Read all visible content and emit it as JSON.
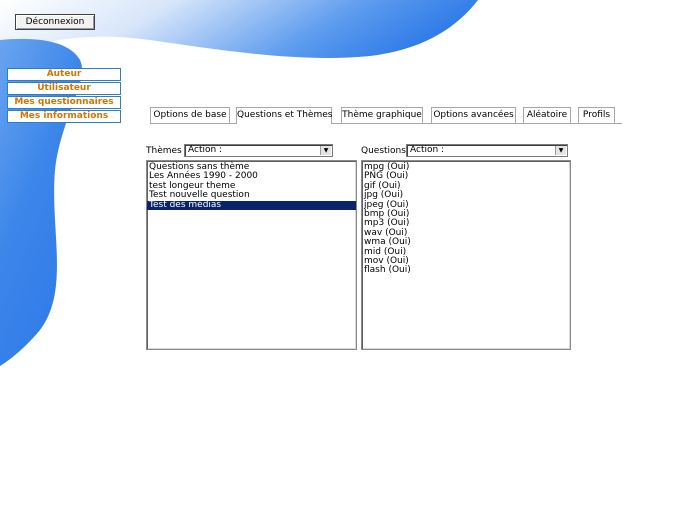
{
  "header": {
    "logout_label": "Déconnexion"
  },
  "side_menu": {
    "items": [
      {
        "label": "Auteur"
      },
      {
        "label": "Utilisateur"
      },
      {
        "label": "Mes questionnaires"
      },
      {
        "label": "Mes informations"
      }
    ]
  },
  "tabs": [
    {
      "label": "Options de base"
    },
    {
      "label": "Questions et Thèmes"
    },
    {
      "label": "Thème graphique"
    },
    {
      "label": "Options avancées"
    },
    {
      "label": "Aléatoire"
    },
    {
      "label": "Profils"
    }
  ],
  "active_tab": "Questions et Thèmes",
  "themes": {
    "label": "Thèmes",
    "action_value": "Action :",
    "items": [
      {
        "label": "Questions sans thème"
      },
      {
        "label": "Les Années 1990 - 2000"
      },
      {
        "label": "test longeur theme"
      },
      {
        "label": "Test nouvelle question"
      },
      {
        "label": "Test des médias"
      }
    ],
    "selected_item": "Test des médias"
  },
  "questions": {
    "label": "Questions",
    "action_value": "Action :",
    "items": [
      {
        "label": "mpg (Oui)"
      },
      {
        "label": "PNG (Oui)"
      },
      {
        "label": "gif (Oui)"
      },
      {
        "label": "jpg (Oui)"
      },
      {
        "label": "jpeg (Oui)"
      },
      {
        "label": "bmp (Oui)"
      },
      {
        "label": "mp3 (Oui)"
      },
      {
        "label": "wav (Oui)"
      },
      {
        "label": "wma (Oui)"
      },
      {
        "label": "mid (Oui)"
      },
      {
        "label": "mov (Oui)"
      },
      {
        "label": "flash (Oui)"
      }
    ]
  },
  "colors": {
    "wave_blue": "#3b86e6",
    "menu_text": "#d47400",
    "selection": "#0a246a"
  }
}
